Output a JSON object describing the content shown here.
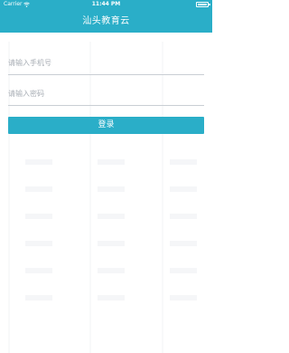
{
  "status_bar": {
    "carrier": "Carrier",
    "time": "11:44 PM"
  },
  "header": {
    "title": "汕头教育云"
  },
  "form": {
    "phone_placeholder": "请输入手机号",
    "password_placeholder": "请输入密码",
    "login_label": "登录"
  },
  "colors": {
    "accent": "#2aaec8",
    "background": "#ffffff"
  }
}
